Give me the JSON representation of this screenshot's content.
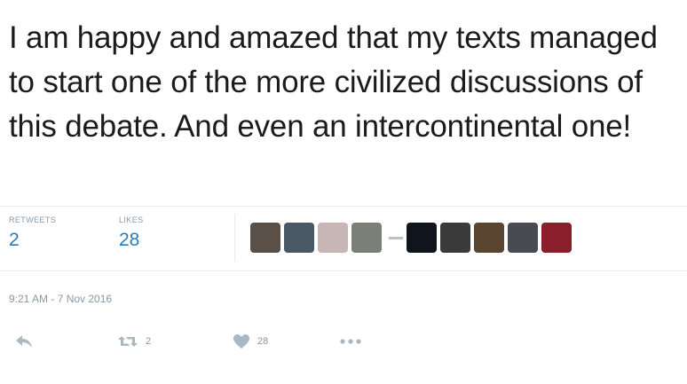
{
  "tweet": {
    "text": "I am happy and amazed that my texts managed to start one of the more civilized discussions of this debate. And even an intercontinental one!",
    "timestamp": "9:21 AM - 7 Nov 2016"
  },
  "stats": {
    "retweets_label": "RETWEETS",
    "retweets_value": "2",
    "likes_label": "LIKES",
    "likes_value": "28"
  },
  "likers_avatars": [
    {
      "name": "avatar-1",
      "color": "#5a5048"
    },
    {
      "name": "avatar-2",
      "color": "#4a5866"
    },
    {
      "name": "avatar-3",
      "color": "#c8b6b4"
    },
    {
      "name": "avatar-4",
      "color": "#7a8078"
    },
    {
      "name": "avatar-5",
      "color": "#10141c"
    },
    {
      "name": "avatar-6",
      "color": "#3a3a3a"
    },
    {
      "name": "avatar-7",
      "color": "#5a4630"
    },
    {
      "name": "avatar-8",
      "color": "#4a4a52"
    },
    {
      "name": "avatar-9",
      "color": "#8a1e2a"
    }
  ],
  "actions": {
    "reply_icon": "reply-icon",
    "retweet_icon": "retweet-icon",
    "retweet_count": "2",
    "like_icon": "heart-icon",
    "like_count": "28",
    "more_icon": "more-icon"
  },
  "colors": {
    "link_blue": "#2b7bb9",
    "muted_gray": "#8899a6",
    "border": "#e6ecf0"
  }
}
